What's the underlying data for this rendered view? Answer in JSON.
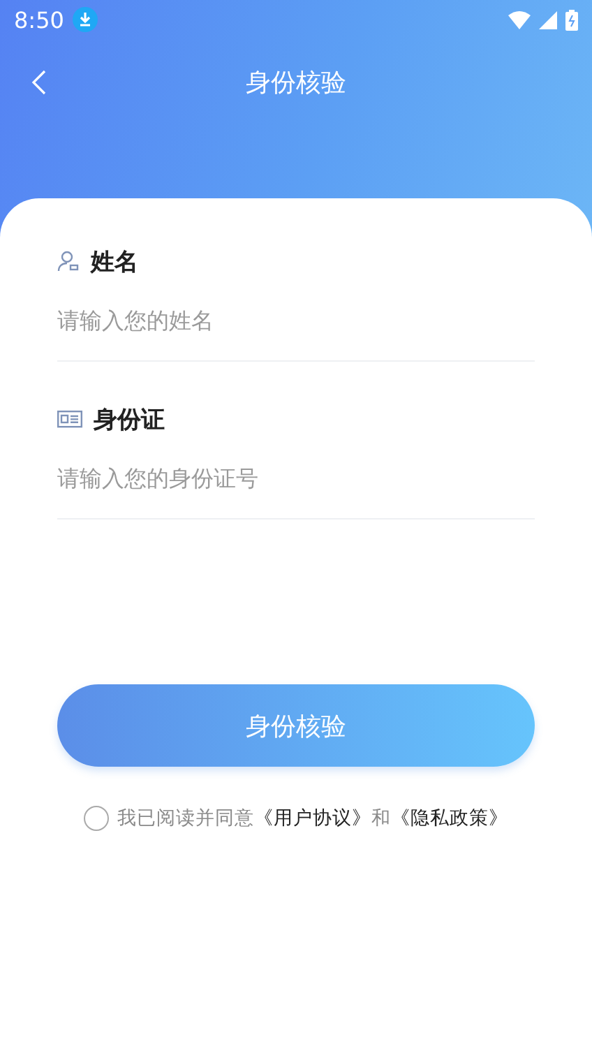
{
  "status_bar": {
    "time": "8:50"
  },
  "header": {
    "title": "身份核验"
  },
  "fields": [
    {
      "kind": "person",
      "label": "姓名",
      "placeholder": "请输入您的姓名"
    },
    {
      "kind": "id-card",
      "label": "身份证",
      "placeholder": "请输入您的身份证号"
    }
  ],
  "submit_button": {
    "label": "身份核验"
  },
  "agreement": {
    "checked": false,
    "text": "我已阅读并同意",
    "links": [
      "《用户协议》",
      "《隐私政策》"
    ],
    "conjunction": "和"
  }
}
